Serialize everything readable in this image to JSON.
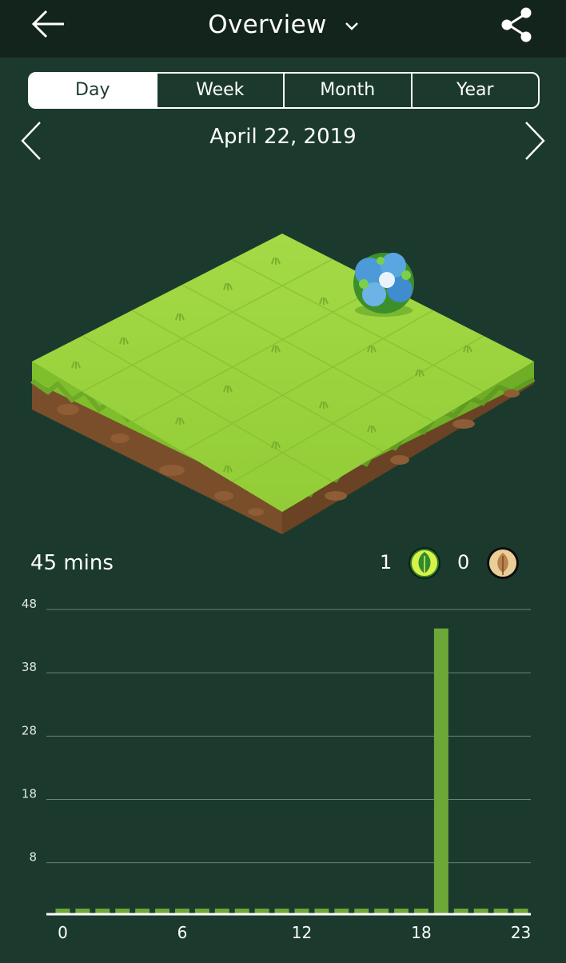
{
  "header": {
    "title": "Overview",
    "back_icon": "arrow-left-icon",
    "dropdown_icon": "chevron-down-icon",
    "share_icon": "share-icon"
  },
  "period_tabs": [
    {
      "label": "Day",
      "active": true
    },
    {
      "label": "Week",
      "active": false
    },
    {
      "label": "Month",
      "active": false
    },
    {
      "label": "Year",
      "active": false
    }
  ],
  "date_nav": {
    "label": "April 22, 2019",
    "prev_icon": "chevron-left-icon",
    "next_icon": "chevron-right-icon"
  },
  "summary": {
    "total_time": "45 mins",
    "healthy_count": "1",
    "healthy_icon": "green-leaf-icon",
    "withered_count": "0",
    "withered_icon": "withered-leaf-icon"
  },
  "colors": {
    "background": "#1b3a2d",
    "topbar": "#13241c",
    "bar": "#6da737",
    "grass": "#9ed63f",
    "soil": "#7a4e2b"
  },
  "chart_data": {
    "type": "bar",
    "x": [
      0,
      1,
      2,
      3,
      4,
      5,
      6,
      7,
      8,
      9,
      10,
      11,
      12,
      13,
      14,
      15,
      16,
      17,
      18,
      19,
      20,
      21,
      22,
      23
    ],
    "values": [
      0,
      0,
      0,
      0,
      0,
      0,
      0,
      0,
      0,
      0,
      0,
      0,
      0,
      0,
      0,
      0,
      0,
      0,
      0,
      45,
      0,
      0,
      0,
      0
    ],
    "x_tick_labels": [
      "0",
      "6",
      "12",
      "18",
      "23"
    ],
    "y_tick_labels": [
      "48",
      "38",
      "28",
      "18",
      "8"
    ],
    "ylim": [
      0,
      48
    ],
    "grid": true
  }
}
